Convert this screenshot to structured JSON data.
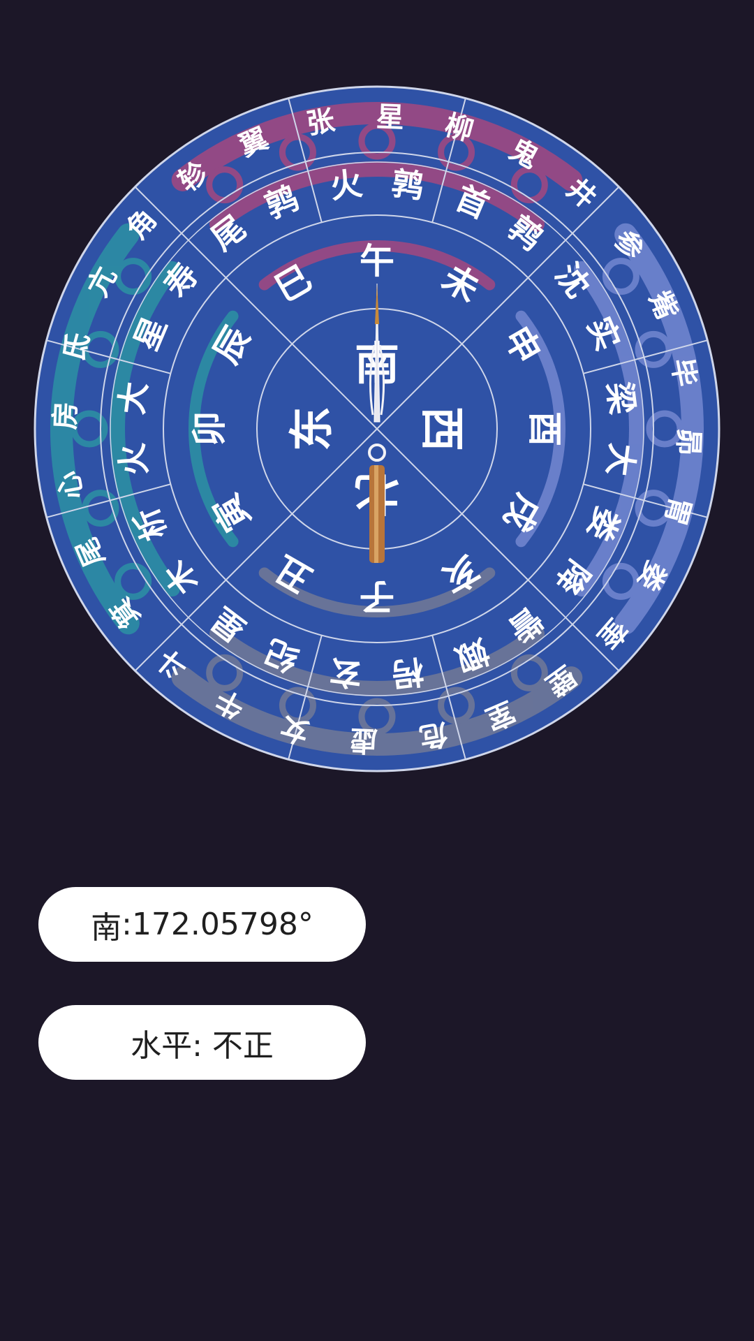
{
  "compass": {
    "outer_ring": [
      "井",
      "鬼",
      "柳",
      "星",
      "张",
      "翼",
      "轸",
      "角",
      "亢",
      "氐",
      "房",
      "心",
      "尾",
      "箕",
      "斗",
      "牛",
      "女",
      "虚",
      "危",
      "室",
      "壁",
      "奎",
      "娄",
      "胃",
      "昴",
      "毕",
      "觜",
      "参"
    ],
    "mansion_ring": [
      "鹑首",
      "鹑火",
      "鹑尾",
      "寿星",
      "大火",
      "析木",
      "星纪",
      "玄枵",
      "娵訾",
      "降娄",
      "大梁",
      "实沈"
    ],
    "branch_ring": [
      "午",
      "巳",
      "辰",
      "卯",
      "寅",
      "丑",
      "子",
      "亥",
      "戌",
      "酉",
      "申",
      "未"
    ],
    "directions": {
      "south": "南",
      "east": "东",
      "north": "北",
      "west": "西"
    },
    "colors": {
      "face": "#2f52a6",
      "lines": "#cfd6ea",
      "text": "#ffffff",
      "dragon_south": "#b4477a",
      "dragon_east": "#2c9aa3",
      "dragon_north": "#7b7f94",
      "dragon_west": "#7d8fd6",
      "needle_tip": "#c98a3a",
      "needle_tail": "#b8753a"
    }
  },
  "heading": {
    "direction": "南",
    "separator": " :",
    "degrees": "172.05798°"
  },
  "level": {
    "label": "水平:",
    "status": "不正"
  }
}
